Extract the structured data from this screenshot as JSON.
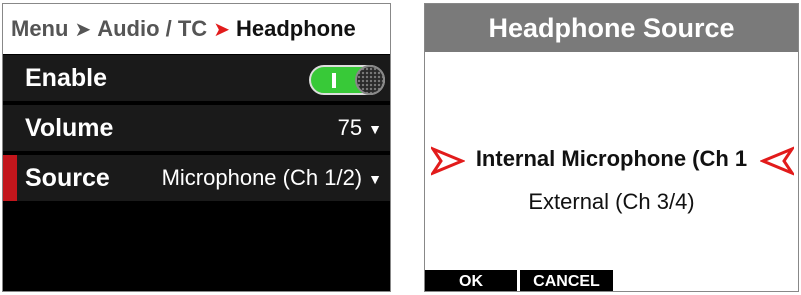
{
  "left": {
    "breadcrumb": [
      "Menu",
      "Audio / TC",
      "Headphone"
    ],
    "rows": {
      "enable": {
        "label": "Enable",
        "toggle_on": true
      },
      "volume": {
        "label": "Volume",
        "value": "75"
      },
      "source": {
        "label": "Source",
        "value": "Microphone (Ch 1/2)",
        "selected": true
      }
    }
  },
  "dialog": {
    "title": "Headphone Source",
    "options": [
      "Internal Microphone (Ch 1",
      "External (Ch 3/4)"
    ],
    "selected_index": 0,
    "buttons": {
      "ok": "OK",
      "cancel": "CANCEL"
    }
  },
  "colors": {
    "accent_red": "#e21b1b",
    "toggle_green": "#38c938",
    "title_bar_gray": "#7a7a7a"
  },
  "icons": {
    "breadcrumb_separator": "chevron-right-icon",
    "dropdown": "chevron-down-icon",
    "selection": "selection-arrow-icon"
  }
}
